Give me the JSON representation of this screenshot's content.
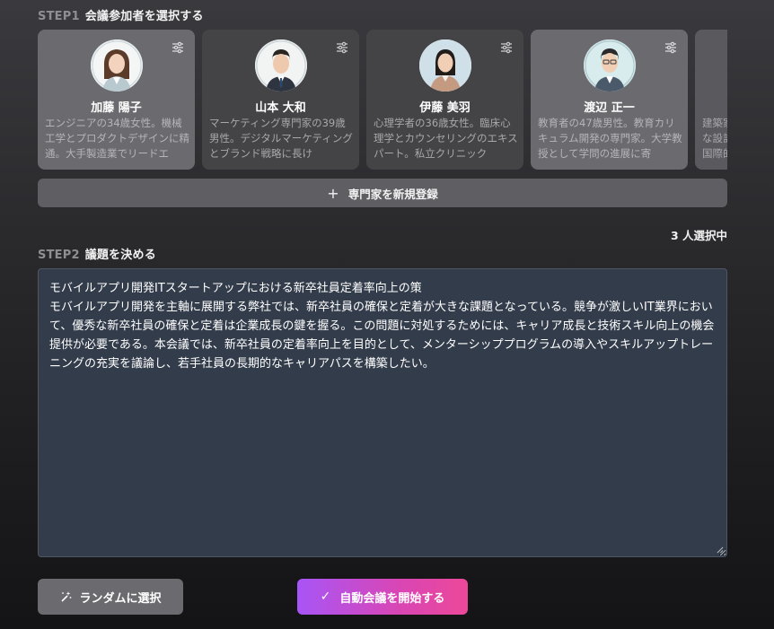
{
  "step1": {
    "num": "STEP1",
    "text": "会議参加者を選択する"
  },
  "experts": [
    {
      "name": "加藤 陽子",
      "desc": "エンジニアの34歳女性。機械工学とプロダクトデザインに精通。大手製造業でリードエ",
      "selected": true
    },
    {
      "name": "山本 大和",
      "desc": "マーケティング専門家の39歳男性。デジタルマーケティングとブランド戦略に長け",
      "selected": false
    },
    {
      "name": "伊藤 美羽",
      "desc": "心理学者の36歳女性。臨床心理学とカウンセリングのエキスパート。私立クリニック",
      "selected": false
    },
    {
      "name": "渡辺 正一",
      "desc": "教育者の47歳男性。教育カリキュラム開発の専門家。大学教授として学問の進展に寄",
      "selected": true
    },
    {
      "name": "",
      "desc": "建築家な設計国際的",
      "selected": false
    }
  ],
  "add_expert": {
    "label": "専門家を新規登録"
  },
  "selected_count": "3 人選択中",
  "step2": {
    "num": "STEP2",
    "text": "議題を決める"
  },
  "topic": "モバイルアプリ開発ITスタートアップにおける新卒社員定着率向上の策\nモバイルアプリ開発を主軸に展開する弊社では、新卒社員の確保と定着が大きな課題となっている。競争が激しいIT業界において、優秀な新卒社員の確保と定着は企業成長の鍵を握る。この問題に対処するためには、キャリア成長と技術スキル向上の機会提供が必要である。本会議では、新卒社員の定着率向上を目的として、メンターシッププログラムの導入やスキルアップトレーニングの充実を議論し、若手社員の長期的なキャリアパスを構築したい。",
  "random_button": {
    "label": "ランダムに選択"
  },
  "start_button": {
    "label": "自動会議を開始する"
  },
  "colors": {
    "start_gradient_from": "#a855f7",
    "start_gradient_to": "#ec4899",
    "card_selected": "#6b6b6f",
    "card_default": "#444446",
    "topic_bg": "#333c4b"
  },
  "icons": {
    "settings": "sliders-icon",
    "add": "plus-icon",
    "random": "magic-wand-icon",
    "start": "check-icon"
  }
}
